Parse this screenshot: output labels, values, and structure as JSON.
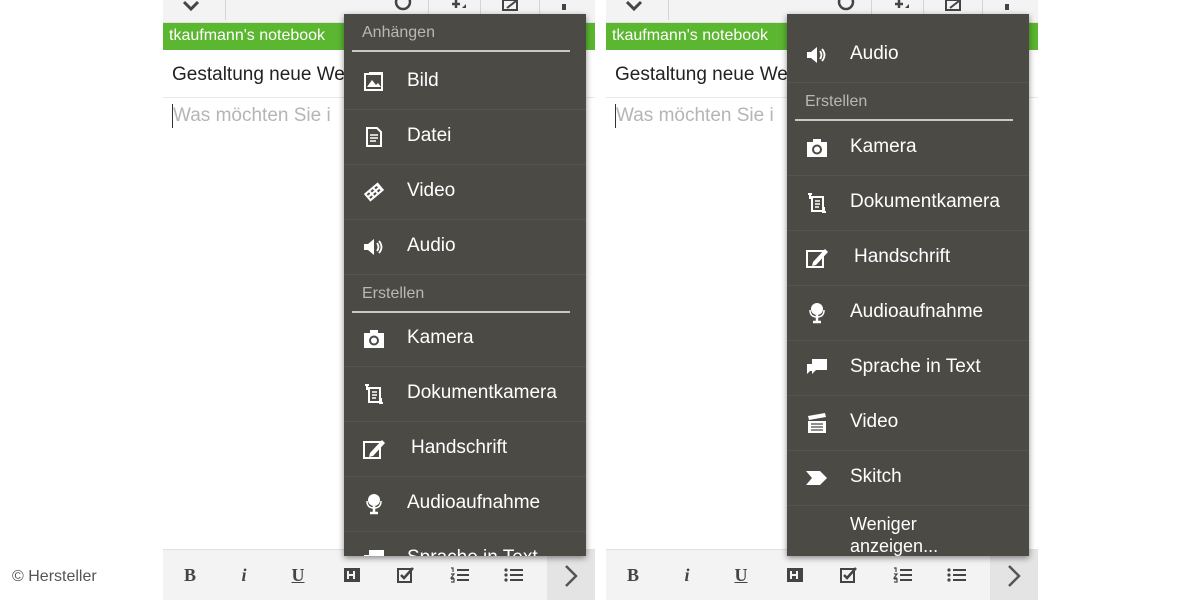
{
  "credit": "© Hersteller",
  "notebook_name": "tkaufmann's notebook",
  "note_title": "Gestaltung neue We",
  "note_body_placeholder": "Was möchten Sie i",
  "format_bar": {
    "bold": "B",
    "italic": "i",
    "underline": "U"
  },
  "left_menu": {
    "attach_header": "Anhängen",
    "attach_items": [
      {
        "label": "Bild",
        "icon": "image-icon"
      },
      {
        "label": "Datei",
        "icon": "file-icon"
      },
      {
        "label": "Video",
        "icon": "video-icon"
      },
      {
        "label": "Audio",
        "icon": "audio-icon"
      }
    ],
    "create_header": "Erstellen",
    "create_items": [
      {
        "label": "Kamera",
        "icon": "camera-icon"
      },
      {
        "label": "Dokumentkamera",
        "icon": "document-camera-icon"
      },
      {
        "label": "Handschrift",
        "icon": "handwriting-icon"
      },
      {
        "label": "Audioaufnahme",
        "icon": "microphone-icon"
      },
      {
        "label": "Sprache in Text",
        "icon": "speech-to-text-icon"
      }
    ]
  },
  "right_menu": {
    "attach_items": [
      {
        "label": "Audio",
        "icon": "audio-icon"
      }
    ],
    "create_header": "Erstellen",
    "create_items": [
      {
        "label": "Kamera",
        "icon": "camera-icon"
      },
      {
        "label": "Dokumentkamera",
        "icon": "document-camera-icon"
      },
      {
        "label": "Handschrift",
        "icon": "handwriting-icon"
      },
      {
        "label": "Audioaufnahme",
        "icon": "microphone-icon"
      },
      {
        "label": "Sprache in Text",
        "icon": "speech-to-text-icon"
      },
      {
        "label": "Video",
        "icon": "video-clapper-icon"
      },
      {
        "label": "Skitch",
        "icon": "skitch-icon"
      }
    ],
    "less_line1": "Weniger",
    "less_line2": "anzeigen..."
  },
  "colors": {
    "notebook_bar": "#5bb630",
    "menu_bg": "#4b4a45",
    "menu_header_text": "#b9b8b2"
  }
}
